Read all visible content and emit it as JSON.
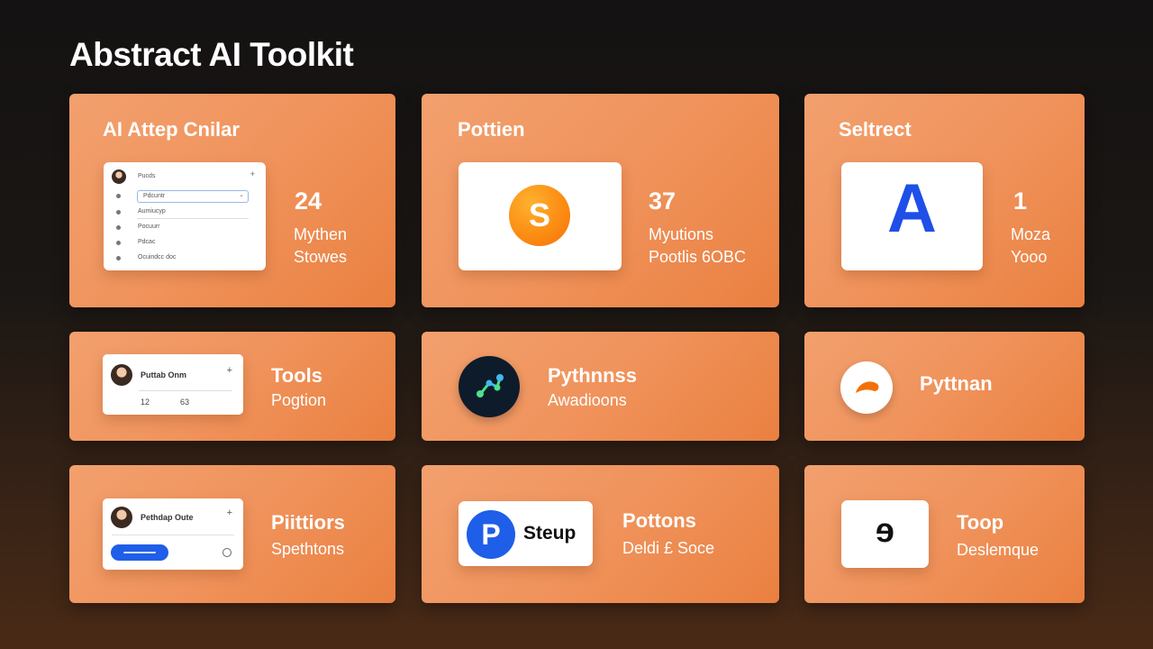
{
  "title": "Abstract AI Toolkit",
  "cards": {
    "c1": {
      "title": "AI Attep Cnilar",
      "number": "24",
      "line1": "Mythen",
      "line2": "Stowes",
      "mock": {
        "header": "Pucds",
        "rows": [
          "Pdcuntr",
          "Aumiucyp",
          "Pocuurr",
          "Pdcac",
          "Ocuindcc doc"
        ]
      }
    },
    "c2": {
      "title": "Pottien",
      "logo_letter": "S",
      "number": "37",
      "line1": "Myutions",
      "line2": "Pootlis 6OBC"
    },
    "c3": {
      "title": "Seltrect",
      "logo_letter": "A",
      "number": "1",
      "line1": "Moza",
      "line2": "Yooo"
    },
    "c4": {
      "name": "Tools",
      "sub": "Pogtion",
      "mock": {
        "header": "Puttab Onm",
        "meta1": "12",
        "meta2": "63"
      }
    },
    "c5": {
      "name": "Pythnnss",
      "sub": "Awadioons"
    },
    "c6": {
      "name": "Pyttnan"
    },
    "c7": {
      "name": "Piittiors",
      "sub": "Spethtons",
      "mock": {
        "header": "Pethdap Oute"
      }
    },
    "c8": {
      "logo_letter": "P",
      "logo_word": "Steup",
      "name": "Pottons",
      "sub": "Deldi £ Soce"
    },
    "c9": {
      "logo_letter": "ɘ",
      "name": "Toop",
      "sub": "Deslemque"
    }
  },
  "colors": {
    "accent_orange": "#f0935c",
    "logo_orange": "#fb8a12",
    "logo_blue": "#1f4fe8",
    "dark_logo": "#0e1b2b"
  }
}
